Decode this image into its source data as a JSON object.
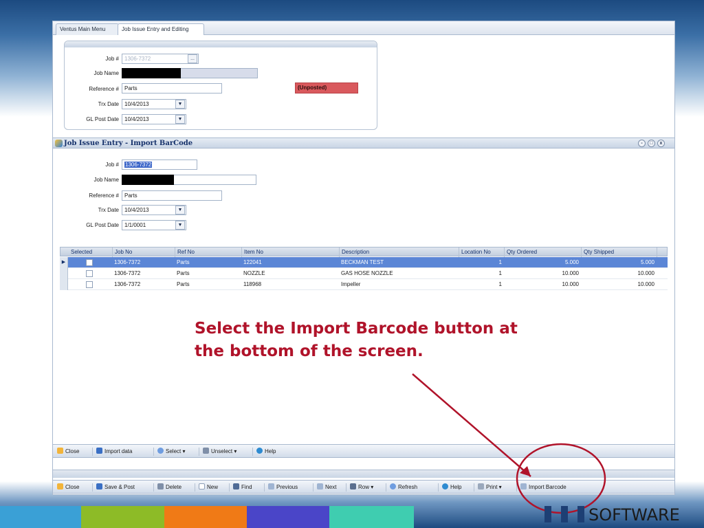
{
  "tabs": [
    {
      "label": "Ventus Main Menu"
    },
    {
      "label": "Job Issue Entry and Editing"
    }
  ],
  "main_form": {
    "job_label": "Job #",
    "job_value": "1306-7372",
    "job_lookup": "...",
    "job_name_label": "Job Name",
    "reference_label": "Reference #",
    "reference_value": "Parts",
    "trx_date_label": "Trx Date",
    "trx_date_value": "10/4/2013",
    "gl_post_date_label": "GL Post Date",
    "gl_post_date_value": "10/4/2013",
    "status": "(Unposted)"
  },
  "import_window": {
    "title": "Job Issue Entry - Import BarCode",
    "job_label": "Job #",
    "job_value": "1306-7372",
    "job_name_label": "Job Name",
    "reference_label": "Reference #",
    "reference_value": "Parts",
    "trx_date_label": "Trx Date",
    "trx_date_value": "10/4/2013",
    "gl_post_date_label": "GL Post Date",
    "gl_post_date_value": "1/1/0001",
    "buttons": {
      "minimize": "-",
      "restore": "□",
      "close": "x"
    }
  },
  "grid": {
    "columns": [
      "Selected",
      "Job No",
      "Ref No",
      "Item No",
      "Description",
      "Location No",
      "Qty Ordered",
      "Qty Shipped"
    ],
    "rows": [
      {
        "job_no": "1306-7372",
        "ref_no": "Parts",
        "item_no": "122041",
        "description": "BECKMAN TEST",
        "location_no": "1",
        "qty_ordered": "5.000",
        "qty_shipped": "5.000",
        "selected": false,
        "current": true
      },
      {
        "job_no": "1306-7372",
        "ref_no": "Parts",
        "item_no": "NOZZLE",
        "description": "GAS HOSE NOZZLE",
        "location_no": "1",
        "qty_ordered": "10.000",
        "qty_shipped": "10.000",
        "selected": false,
        "current": false
      },
      {
        "job_no": "1306-7372",
        "ref_no": "Parts",
        "item_no": "118968",
        "description": "Impeller",
        "location_no": "1",
        "qty_ordered": "10.000",
        "qty_shipped": "10.000",
        "selected": false,
        "current": false
      }
    ]
  },
  "import_toolbar": {
    "close": "Close",
    "import_data": "Import data",
    "select": "Select ▾",
    "unselect": "Unselect ▾",
    "help": "Help"
  },
  "main_toolbar": {
    "close": "Close",
    "save_post": "Save & Post",
    "delete": "Delete",
    "new": "New",
    "find": "Find",
    "previous": "Previous",
    "next": "Next",
    "row": "Row ▾",
    "refresh": "Refresh",
    "help": "Help",
    "print": "Print ▾",
    "import_barcode": "Import Barcode"
  },
  "callout": {
    "line1": "Select the Import Barcode button at",
    "line2": "the bottom of the screen.",
    "color": "#b0132a"
  },
  "logo": {
    "text": "SOFTWARE"
  },
  "colors": {
    "band": "#1c4a80",
    "stripe": [
      "#3aa0d6",
      "#8dbb27",
      "#f07a16",
      "#4a45c8",
      "#3fcdb0"
    ]
  }
}
